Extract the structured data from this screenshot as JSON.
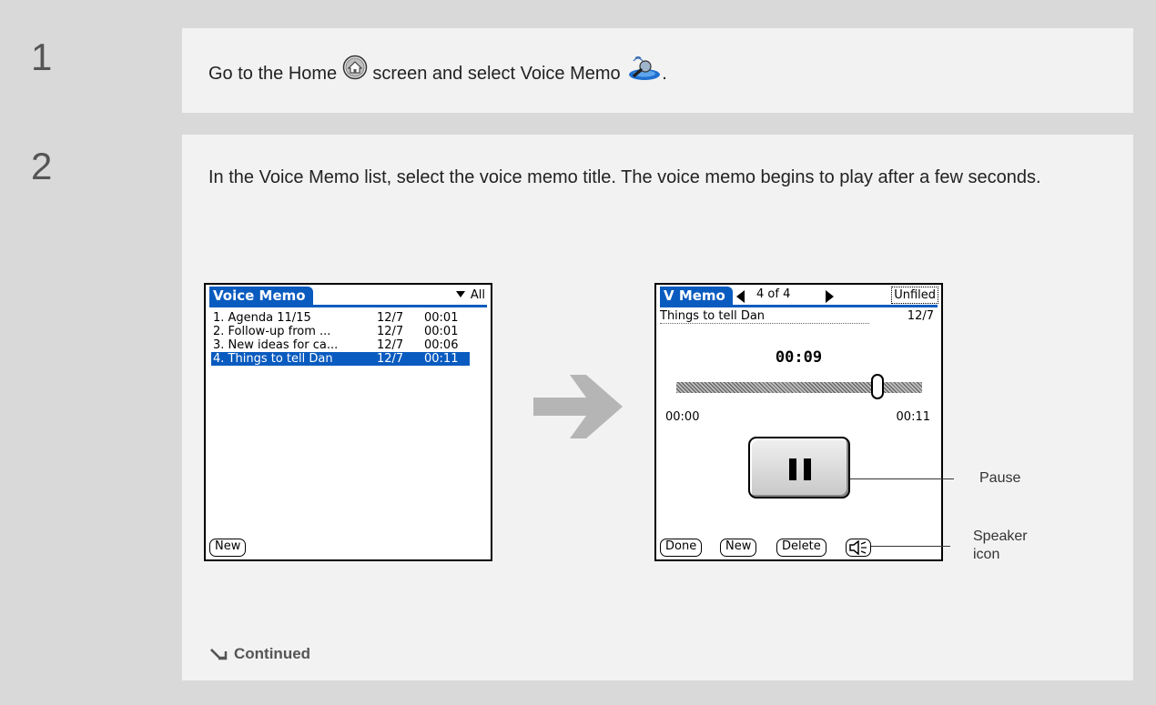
{
  "step1": {
    "number": "1",
    "text_before": "Go to the Home",
    "text_middle": "screen and select Voice Memo",
    "text_after": ".",
    "home_icon": "home-icon",
    "voice_memo_icon": "voice-memo-icon"
  },
  "step2": {
    "number": "2",
    "text": "In the Voice Memo list, select the voice memo title. The voice memo begins to play after a few seconds."
  },
  "list_screen": {
    "title": "Voice Memo",
    "category": "All",
    "memos": [
      {
        "title": "1. Agenda 11/15",
        "date": "12/7",
        "duration": "00:01"
      },
      {
        "title": "2. Follow-up from ...",
        "date": "12/7",
        "duration": "00:01"
      },
      {
        "title": "3. New ideas for ca...",
        "date": "12/7",
        "duration": "00:06"
      },
      {
        "title": "4. Things to tell Dan",
        "date": "12/7",
        "duration": "00:11"
      }
    ],
    "selected_index": 3,
    "new_button": "New"
  },
  "detail_screen": {
    "title": "V Memo",
    "record_counter": "4 of 4",
    "category": "Unfiled",
    "memo_title": "Things to tell Dan",
    "memo_date": "12/7",
    "elapsed": "00:09",
    "time_start": "00:00",
    "time_end": "00:11",
    "progress": 0.82,
    "buttons": {
      "done": "Done",
      "new": "New",
      "delete": "Delete"
    }
  },
  "callouts": {
    "pause": "Pause",
    "speaker_line1": "Speaker",
    "speaker_line2": "icon"
  },
  "continued": "Continued",
  "colors": {
    "frame": "#d9d9d9",
    "panel": "#f2f2f2",
    "palm_blue": "#0a5bbf",
    "arrow_gray": "#b5b5b5"
  }
}
